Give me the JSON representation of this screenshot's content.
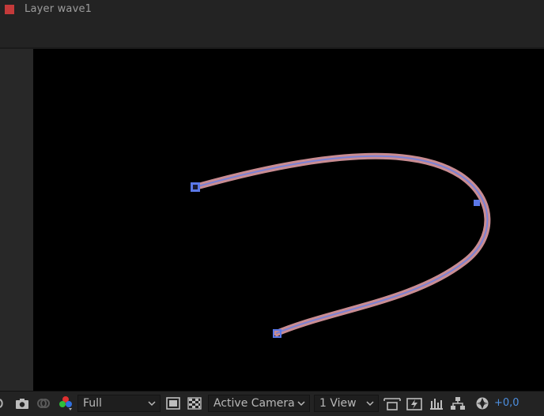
{
  "header": {
    "title": "Layer  wave1",
    "layer_color": "#c43a3a"
  },
  "viewer": {
    "background": "#000000",
    "path_color": "#c98c92",
    "path_center_color": "#7b82d6",
    "handle_color": "#5b78e8"
  },
  "toolbar": {
    "resolution_label": "Full",
    "camera_label": "Active Camera",
    "view_layout_label": "1 View",
    "exposure_value": "+0,0",
    "icons": [
      "magnification-icon",
      "snapshot-camera-icon",
      "show-snapshot-icon",
      "color-channels-icon",
      "region-of-interest-icon",
      "transparency-grid-icon",
      "toggle-pixel-aspect-icon",
      "fast-previews-icon",
      "timeline-icon",
      "flowchart-icon",
      "reset-exposure-icon"
    ]
  }
}
